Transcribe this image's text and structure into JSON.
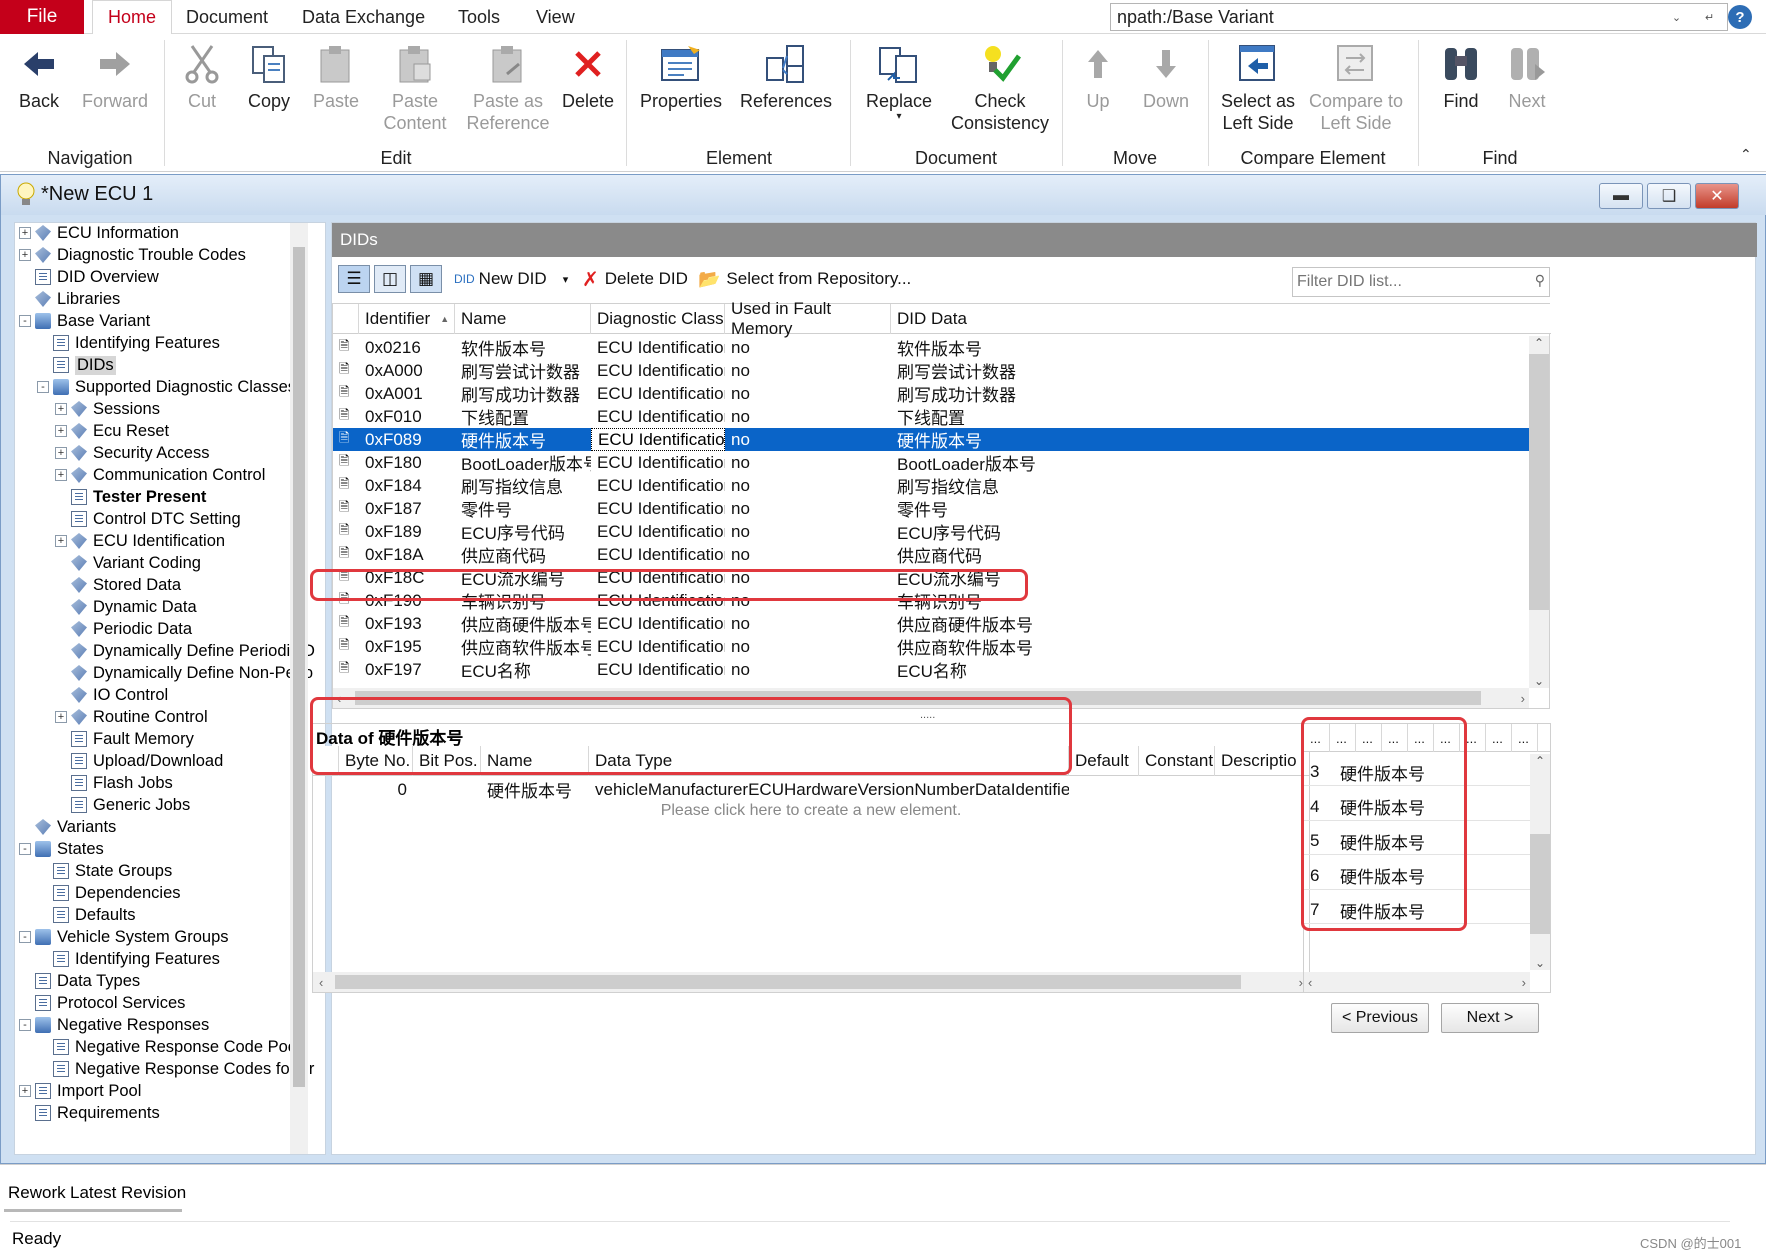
{
  "menu": {
    "file": "File",
    "tabs": [
      "Home",
      "Document",
      "Data Exchange",
      "Tools",
      "View"
    ],
    "npath": "npath:/Base Variant",
    "help": "?"
  },
  "ribbon": {
    "back": "Back",
    "forward": "Forward",
    "cut": "Cut",
    "copy": "Copy",
    "paste": "Paste",
    "paste_content_1": "Paste",
    "paste_content_2": "Content",
    "paste_ref_1": "Paste as",
    "paste_ref_2": "Reference",
    "delete": "Delete",
    "properties": "Properties",
    "references": "References",
    "replace": "Replace",
    "check_1": "Check",
    "check_2": "Consistency",
    "up": "Up",
    "down": "Down",
    "select_left_1": "Select as",
    "select_left_2": "Left Side",
    "compare_left_1": "Compare to",
    "compare_left_2": "Left Side",
    "find": "Find",
    "next": "Next",
    "groups": {
      "navigation": "Navigation",
      "edit": "Edit",
      "element": "Element",
      "document": "Document",
      "move": "Move",
      "compare": "Compare Element",
      "find": "Find"
    }
  },
  "window": {
    "title": "*New ECU 1"
  },
  "tree": [
    {
      "label": "ECU Information",
      "level": 0,
      "exp": "+",
      "icon": "gem"
    },
    {
      "label": "Diagnostic Trouble Codes",
      "level": 0,
      "exp": "+",
      "icon": "gem"
    },
    {
      "label": "DID Overview",
      "level": 0,
      "exp": "",
      "icon": "doc"
    },
    {
      "label": "Libraries",
      "level": 0,
      "exp": "",
      "icon": "gem"
    },
    {
      "label": "Base Variant",
      "level": 0,
      "exp": "-",
      "icon": "book"
    },
    {
      "label": "Identifying Features",
      "level": 1,
      "exp": "",
      "icon": "doc"
    },
    {
      "label": "DIDs",
      "level": 1,
      "exp": "",
      "icon": "doc",
      "sel": true
    },
    {
      "label": "Supported Diagnostic Classes",
      "level": 1,
      "exp": "-",
      "icon": "book"
    },
    {
      "label": "Sessions",
      "level": 2,
      "exp": "+",
      "icon": "gem"
    },
    {
      "label": "Ecu Reset",
      "level": 2,
      "exp": "+",
      "icon": "gem"
    },
    {
      "label": "Security Access",
      "level": 2,
      "exp": "+",
      "icon": "gem"
    },
    {
      "label": "Communication Control",
      "level": 2,
      "exp": "+",
      "icon": "gem"
    },
    {
      "label": "Tester Present",
      "level": 2,
      "exp": "",
      "icon": "doc",
      "bold": true
    },
    {
      "label": "Control DTC Setting",
      "level": 2,
      "exp": "",
      "icon": "doc"
    },
    {
      "label": "ECU Identification",
      "level": 2,
      "exp": "+",
      "icon": "gem"
    },
    {
      "label": "Variant Coding",
      "level": 2,
      "exp": "",
      "icon": "gem"
    },
    {
      "label": "Stored Data",
      "level": 2,
      "exp": "",
      "icon": "gem"
    },
    {
      "label": "Dynamic Data",
      "level": 2,
      "exp": "",
      "icon": "gem"
    },
    {
      "label": "Periodic Data",
      "level": 2,
      "exp": "",
      "icon": "gem"
    },
    {
      "label": "Dynamically Define Periodic D",
      "level": 2,
      "exp": "",
      "icon": "gem"
    },
    {
      "label": "Dynamically Define Non-Perio",
      "level": 2,
      "exp": "",
      "icon": "gem"
    },
    {
      "label": "IO Control",
      "level": 2,
      "exp": "",
      "icon": "gem"
    },
    {
      "label": "Routine Control",
      "level": 2,
      "exp": "+",
      "icon": "gem"
    },
    {
      "label": "Fault Memory",
      "level": 2,
      "exp": "",
      "icon": "doc"
    },
    {
      "label": "Upload/Download",
      "level": 2,
      "exp": "",
      "icon": "doc"
    },
    {
      "label": "Flash Jobs",
      "level": 2,
      "exp": "",
      "icon": "doc"
    },
    {
      "label": "Generic Jobs",
      "level": 2,
      "exp": "",
      "icon": "doc"
    },
    {
      "label": "Variants",
      "level": 0,
      "exp": "",
      "icon": "gem"
    },
    {
      "label": "States",
      "level": 0,
      "exp": "-",
      "icon": "book"
    },
    {
      "label": "State Groups",
      "level": 1,
      "exp": "",
      "icon": "doc"
    },
    {
      "label": "Dependencies",
      "level": 1,
      "exp": "",
      "icon": "doc"
    },
    {
      "label": "Defaults",
      "level": 1,
      "exp": "",
      "icon": "doc"
    },
    {
      "label": "Vehicle System Groups",
      "level": 0,
      "exp": "-",
      "icon": "book"
    },
    {
      "label": "Identifying Features",
      "level": 1,
      "exp": "",
      "icon": "doc"
    },
    {
      "label": "Data Types",
      "level": 0,
      "exp": "",
      "icon": "doc"
    },
    {
      "label": "Protocol Services",
      "level": 0,
      "exp": "",
      "icon": "doc"
    },
    {
      "label": "Negative Responses",
      "level": 0,
      "exp": "-",
      "icon": "book"
    },
    {
      "label": "Negative Response Code Pool",
      "level": 1,
      "exp": "",
      "icon": "doc"
    },
    {
      "label": "Negative Response Codes for ur",
      "level": 1,
      "exp": "",
      "icon": "doc"
    },
    {
      "label": "Import Pool",
      "level": 0,
      "exp": "+",
      "icon": "doc"
    },
    {
      "label": "Requirements",
      "level": 0,
      "exp": "",
      "icon": "doc"
    }
  ],
  "dids": {
    "header": "DIDs",
    "toolbar": {
      "new": "New DID",
      "delete": "Delete DID",
      "repo": "Select from Repository..."
    },
    "filter_placeholder": "Filter DID list...",
    "columns": [
      "Identifier",
      "Name",
      "Diagnostic Class",
      "Used in Fault Memory",
      "DID Data"
    ],
    "rows": [
      [
        "0x0216",
        "软件版本号",
        "ECU Identification",
        "no",
        "软件版本号"
      ],
      [
        "0xA000",
        "刷写尝试计数器",
        "ECU Identification",
        "no",
        "刷写尝试计数器"
      ],
      [
        "0xA001",
        "刷写成功计数器",
        "ECU Identification",
        "no",
        "刷写成功计数器"
      ],
      [
        "0xF010",
        "下线配置",
        "ECU Identification",
        "no",
        "下线配置"
      ],
      [
        "0xF089",
        "硬件版本号",
        "ECU Identification",
        "no",
        "硬件版本号"
      ],
      [
        "0xF180",
        "BootLoader版本号",
        "ECU Identification",
        "no",
        "BootLoader版本号"
      ],
      [
        "0xF184",
        "刷写指纹信息",
        "ECU Identification",
        "no",
        "刷写指纹信息"
      ],
      [
        "0xF187",
        "零件号",
        "ECU Identification",
        "no",
        "零件号"
      ],
      [
        "0xF189",
        "ECU序号代码",
        "ECU Identification",
        "no",
        "ECU序号代码"
      ],
      [
        "0xF18A",
        "供应商代码",
        "ECU Identification",
        "no",
        "供应商代码"
      ],
      [
        "0xF18C",
        "ECU流水编号",
        "ECU Identification",
        "no",
        " ECU流水编号"
      ],
      [
        "0xF190",
        "车辆识别号",
        "ECU Identification",
        "no",
        "车辆识别号"
      ],
      [
        "0xF193",
        "供应商硬件版本号",
        "ECU Identification",
        "no",
        "供应商硬件版本号"
      ],
      [
        "0xF195",
        "供应商软件版本号",
        "ECU Identification",
        "no",
        "供应商软件版本号"
      ],
      [
        "0xF197",
        "ECU名称",
        "ECU Identification",
        "no",
        "ECU名称"
      ]
    ],
    "selected_index": 4,
    "splitter": "....."
  },
  "data_panel": {
    "title": "Data of 硬件版本号",
    "columns": [
      "Byte No.",
      "Bit Pos.",
      "Name",
      "Data Type",
      "Default",
      "Constant",
      "Descriptio"
    ],
    "row": {
      "byte": "0",
      "bit": "",
      "name": "硬件版本号",
      "type": "vehicleManufacturerECUHardwareVersionNumberDataIdentifier"
    },
    "hint": "Please click here to create a new element."
  },
  "side_panel": {
    "header_cols": [
      "...",
      "...",
      "...",
      "...",
      "...",
      "...",
      "...",
      "...",
      "..."
    ],
    "rows": [
      [
        "3",
        "硬件版本号"
      ],
      [
        "4",
        "硬件版本号"
      ],
      [
        "5",
        "硬件版本号"
      ],
      [
        "6",
        "硬件版本号"
      ],
      [
        "7",
        "硬件版本号"
      ]
    ]
  },
  "buttons": {
    "previous": "< Previous",
    "next": "Next >"
  },
  "status": {
    "tab1": "Rework",
    "tab2": "Latest Revision",
    "ready": "Ready",
    "watermark": "CSDN @的士001"
  },
  "colors": {
    "accent": "#c4001a",
    "selection": "#0a64c8",
    "highlight_box": "#e0383e"
  }
}
